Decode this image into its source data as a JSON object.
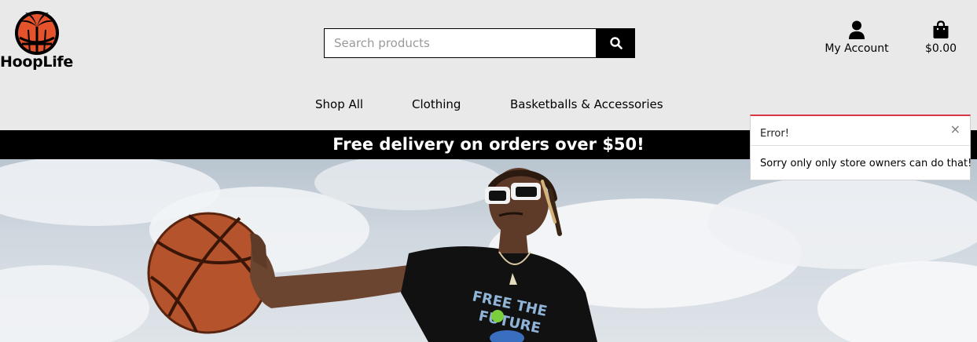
{
  "brand": {
    "name": "HoopLife"
  },
  "search": {
    "placeholder": "Search products",
    "value": ""
  },
  "header": {
    "account_label": "My Account",
    "cart_total": "$0.00"
  },
  "nav": {
    "items": [
      {
        "label": "Shop All"
      },
      {
        "label": "Clothing"
      },
      {
        "label": "Basketballs & Accessories"
      }
    ]
  },
  "banner": {
    "text": "Free delivery on orders over $50!"
  },
  "toast": {
    "title": "Error!",
    "close": "×",
    "message": "Sorry only only store owners can do that!"
  },
  "colors": {
    "accent": "#000000",
    "error": "#dc3545",
    "background": "#e9e9e9",
    "logo_orange": "#e4532b"
  },
  "icons": {
    "search": "search-icon",
    "account": "user-icon",
    "cart": "shopping-bag-icon",
    "close": "close-icon"
  }
}
